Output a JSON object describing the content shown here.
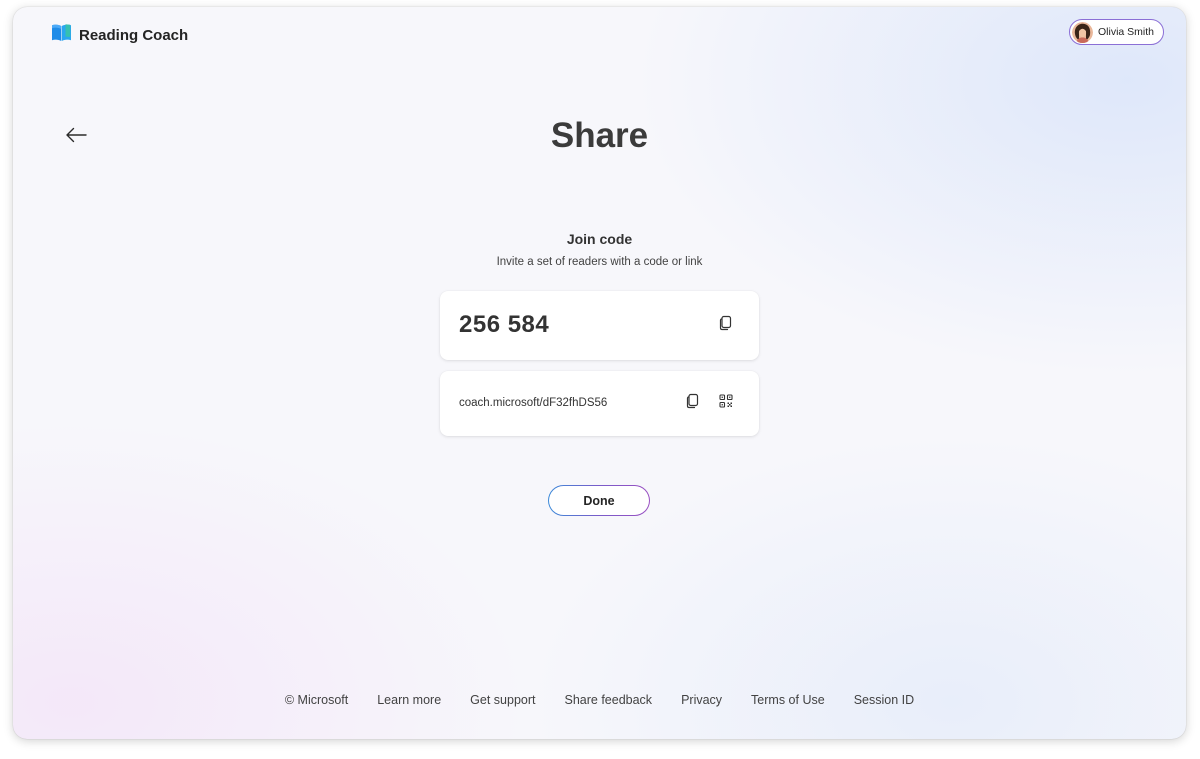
{
  "app": {
    "title": "Reading Coach",
    "icon": "book-icon"
  },
  "user": {
    "name": "Olivia Smith",
    "avatar_icon": "avatar"
  },
  "header": {
    "back_icon": "arrow-left-icon",
    "title": "Share"
  },
  "join": {
    "title": "Join code",
    "subtitle": "Invite a set of readers with a code or link",
    "code": "256 584",
    "code_copy_icon": "copy-icon",
    "link": "coach.microsoft/dF32fhDS56",
    "link_copy_icon": "copy-icon",
    "link_qr_icon": "qr-code-icon"
  },
  "actions": {
    "done_label": "Done"
  },
  "footer": {
    "copyright": "© Microsoft",
    "links": [
      "Learn more",
      "Get support",
      "Share feedback",
      "Privacy",
      "Terms of Use",
      "Session ID"
    ]
  },
  "colors": {
    "button_gradient_start": "#3b8ad9",
    "button_gradient_end": "#9a4fc2",
    "user_chip_border": "#8b6fd6"
  }
}
